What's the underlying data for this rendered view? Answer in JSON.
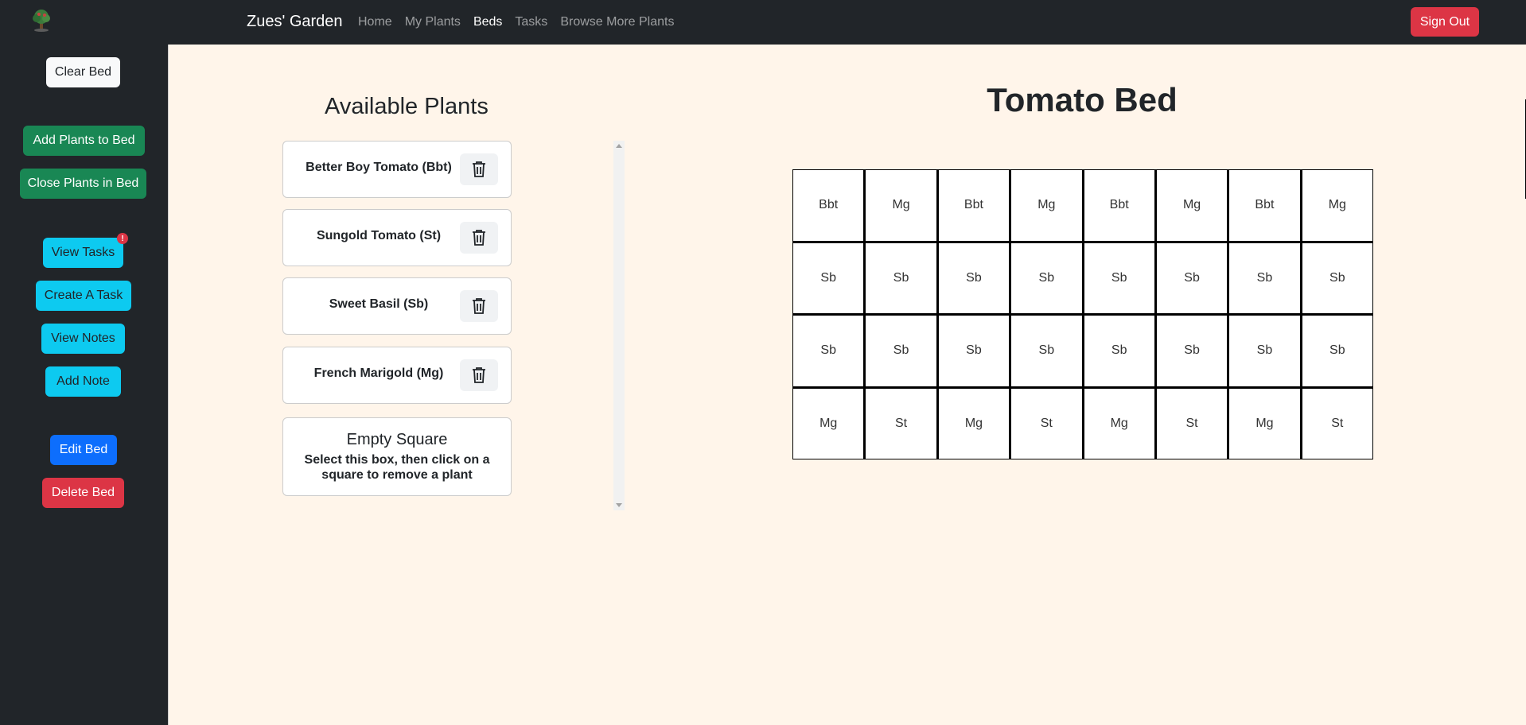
{
  "navbar": {
    "brand": "Zues' Garden",
    "links": [
      "Home",
      "My Plants",
      "Beds",
      "Tasks",
      "Browse More Plants"
    ],
    "active_link": "Beds",
    "signout_label": "Sign Out",
    "logo_icon": "tree-icon"
  },
  "sidebar": {
    "clear_bed": "Clear Bed",
    "add_plants": "Add Plants to Bed",
    "close_plants": "Close Plants in Bed",
    "view_tasks": "View Tasks",
    "tasks_badge": "!",
    "create_task": "Create A Task",
    "view_notes": "View Notes",
    "add_note": "Add Note",
    "edit_bed": "Edit Bed",
    "delete_bed": "Delete Bed"
  },
  "available": {
    "title": "Available Plants",
    "plants": [
      {
        "name": "Better Boy Tomato (Bbt)",
        "icon": "trash-icon"
      },
      {
        "name": "Sungold Tomato (St)",
        "icon": "trash-icon"
      },
      {
        "name": "Sweet Basil (Sb)",
        "icon": "trash-icon"
      },
      {
        "name": "French Marigold (Mg)",
        "icon": "trash-icon"
      }
    ],
    "empty_title": "Empty Square",
    "empty_desc": "Select this box, then click on a square to remove a plant"
  },
  "bed": {
    "title": "Tomato Bed",
    "rows": [
      [
        "Bbt",
        "Mg",
        "Bbt",
        "Mg",
        "Bbt",
        "Mg",
        "Bbt",
        "Mg"
      ],
      [
        "Sb",
        "Sb",
        "Sb",
        "Sb",
        "Sb",
        "Sb",
        "Sb",
        "Sb"
      ],
      [
        "Sb",
        "Sb",
        "Sb",
        "Sb",
        "Sb",
        "Sb",
        "Sb",
        "Sb"
      ],
      [
        "Mg",
        "St",
        "Mg",
        "St",
        "Mg",
        "St",
        "Mg",
        "St"
      ]
    ]
  },
  "colors": {
    "navbar": "#212529",
    "background": "#fff5ea",
    "success": "#198754",
    "info": "#0dcaf0",
    "primary": "#0d6efd",
    "danger": "#dc3545"
  }
}
